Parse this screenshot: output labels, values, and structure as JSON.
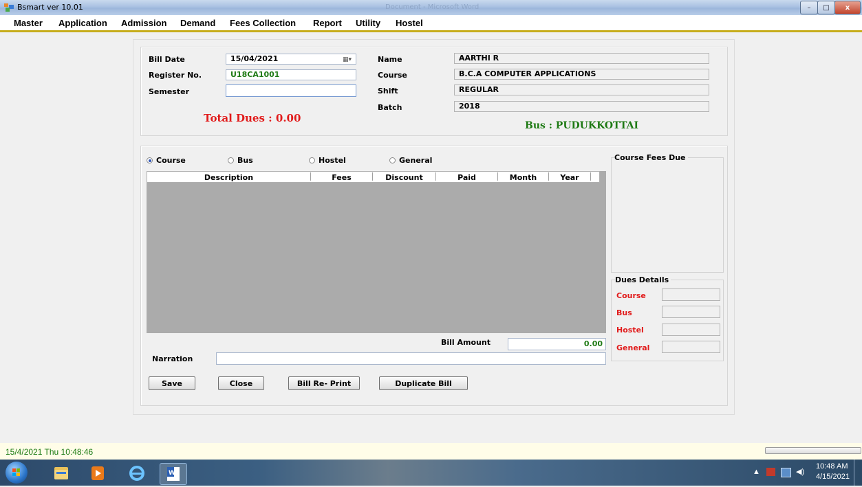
{
  "window": {
    "title": "Bsmart ver 10.01",
    "ghost_title": "Document - Microsoft Word",
    "minimize": "–",
    "maximize": "□",
    "close": "x"
  },
  "menu": [
    "Master",
    "Application",
    "Admission",
    "Demand",
    "Fees Collection",
    "Report",
    "Utility",
    "Hostel"
  ],
  "header": {
    "bill_date_label": "Bill Date",
    "bill_date_value": "15/04/2021",
    "register_label": "Register No.",
    "register_value": "U18CA1001",
    "semester_label": "Semester",
    "semester_value": "",
    "total_dues": "Total Dues : 0.00",
    "name_label": "Name",
    "name_value": "AARTHI R",
    "course_label": "Course",
    "course_value": "B.C.A COMPUTER APPLICATIONS",
    "shift_label": "Shift",
    "shift_value": "REGULAR",
    "batch_label": "Batch",
    "batch_value": "2018",
    "bus_text": "Bus : PUDUKKOTTAI"
  },
  "fee_types": [
    {
      "label": "Course",
      "selected": true
    },
    {
      "label": "Bus",
      "selected": false
    },
    {
      "label": "Hostel",
      "selected": false
    },
    {
      "label": "General",
      "selected": false
    }
  ],
  "grid_columns": [
    "Description",
    "Fees",
    "Discount",
    "Paid",
    "Month",
    "Year"
  ],
  "bill_amount_label": "Bill Amount",
  "bill_amount_value": "0.00",
  "narration_label": "Narration",
  "narration_value": "",
  "buttons": {
    "save": "Save",
    "close": "Close",
    "reprint": "Bill Re- Print",
    "duplicate": "Duplicate Bill"
  },
  "course_fees_due_title": "Course Fees Due",
  "dues_details": {
    "title": "Dues Details",
    "course": "Course",
    "bus": "Bus",
    "hostel": "Hostel",
    "general": "General"
  },
  "status": {
    "datetime": "15/4/2021 Thu 10:48:46"
  },
  "taskbar": {
    "time": "10:48 AM",
    "date": "4/15/2021"
  },
  "colors": {
    "accent_green": "#1e7a14",
    "accent_red": "#e11b1b",
    "menu_underline": "#c7ad1c"
  }
}
